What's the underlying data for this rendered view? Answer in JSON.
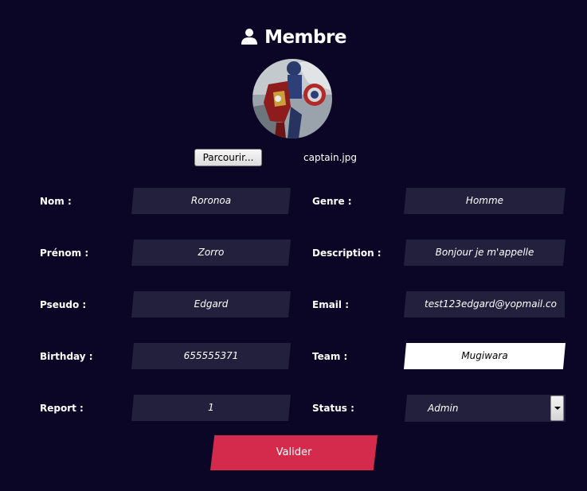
{
  "header": {
    "title": "Membre",
    "icon": "user-icon"
  },
  "avatar": {
    "alt": "captain.jpg",
    "icon": "avatar-image"
  },
  "upload": {
    "browse_label": "Parcourir...",
    "file_name": "captain.jpg"
  },
  "form": {
    "nom": {
      "label": "Nom :",
      "value": "Roronoa"
    },
    "prenom": {
      "label": "Prénom :",
      "value": "Zorro"
    },
    "pseudo": {
      "label": "Pseudo :",
      "value": "Edgard"
    },
    "birthday": {
      "label": "Birthday :",
      "value": "655555371"
    },
    "report": {
      "label": "Report :",
      "value": "1"
    },
    "genre": {
      "label": "Genre :",
      "value": "Homme"
    },
    "description": {
      "label": "Description :",
      "value": "Bonjour je m'appelle"
    },
    "email": {
      "label": "Email :",
      "value": "test123edgard@yopmail.co"
    },
    "team": {
      "label": "Team :",
      "value": "Mugiwara"
    },
    "status": {
      "label": "Status :",
      "value": "Admin"
    }
  },
  "submit": {
    "label": "Valider"
  },
  "colors": {
    "background": "#0c0626",
    "input_background": "#23203d",
    "submit": "#d42a4b",
    "text": "#ffffff"
  }
}
